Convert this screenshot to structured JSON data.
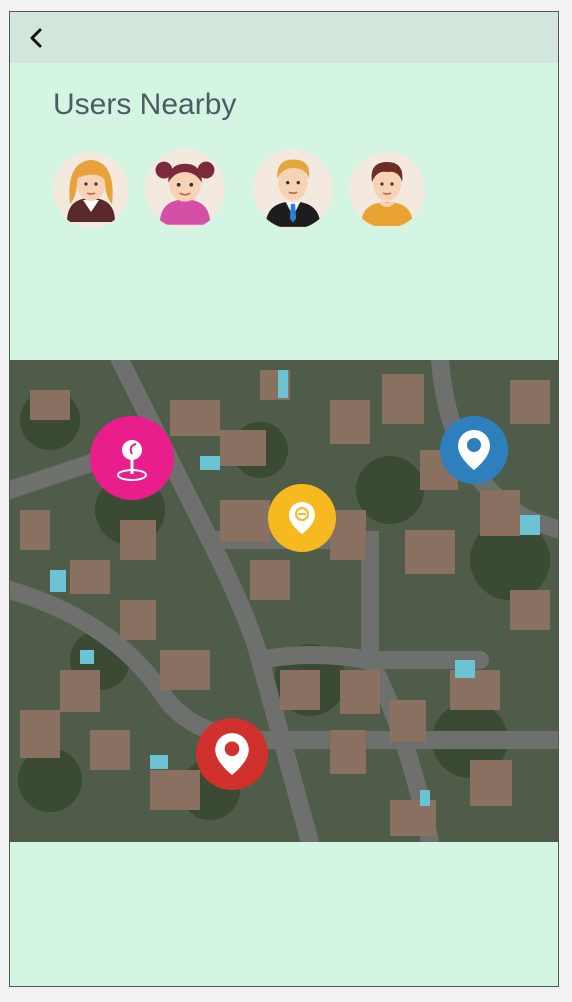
{
  "header": {
    "back_icon": "chevron-left-icon",
    "title": "Users Nearby"
  },
  "users": [
    {
      "name": "user-1",
      "hair": "#e8a23a",
      "shirt": "#5a2a2a",
      "icon": "female-avatar-icon"
    },
    {
      "name": "user-2",
      "hair": "#7a2a3a",
      "shirt": "#d64fa6",
      "icon": "female-avatar-icon"
    },
    {
      "name": "user-3",
      "hair": "#e3a63c",
      "shirt": "#1d1d1d",
      "icon": "male-avatar-icon"
    },
    {
      "name": "user-4",
      "hair": "#6b2d24",
      "shirt": "#e9a332",
      "icon": "male-avatar-icon"
    }
  ],
  "map": {
    "markers": [
      {
        "icon": "pin-on-map-icon",
        "color": "#e91e8c"
      },
      {
        "icon": "location-pin-icon",
        "color": "#2e7fbd"
      },
      {
        "icon": "location-minus-icon",
        "color": "#f6b920"
      },
      {
        "icon": "location-pin-icon",
        "color": "#d0312d"
      }
    ]
  }
}
